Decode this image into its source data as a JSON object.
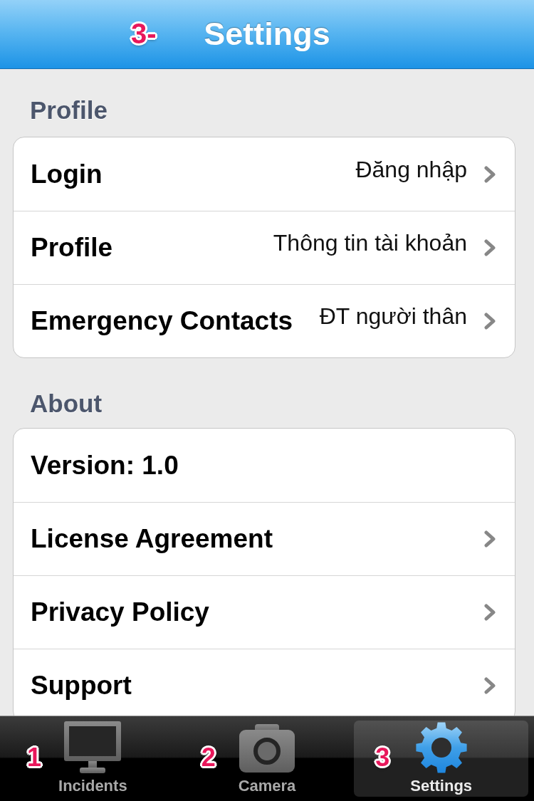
{
  "nav_bar": {
    "title": "Settings",
    "annotation": "3-"
  },
  "sections": [
    {
      "header": "Profile",
      "rows": [
        {
          "label": "Login",
          "note": "Đăng nhập",
          "disclosure": true
        },
        {
          "label": "Profile",
          "note": "Thông tin tài khoản",
          "disclosure": true
        },
        {
          "label": "Emergency Contacts",
          "note": "ĐT người thân",
          "disclosure": true
        }
      ]
    },
    {
      "header": "About",
      "rows": [
        {
          "label": "Version: 1.0",
          "disclosure": false
        },
        {
          "label": "License Agreement",
          "disclosure": true
        },
        {
          "label": "Privacy Policy",
          "disclosure": true
        },
        {
          "label": "Support",
          "disclosure": true
        }
      ]
    }
  ],
  "tab_bar": [
    {
      "label": "Incidents",
      "annotation": "1",
      "selected": false
    },
    {
      "label": "Camera",
      "annotation": "2",
      "selected": false
    },
    {
      "label": "Settings",
      "annotation": "3",
      "selected": true
    }
  ]
}
